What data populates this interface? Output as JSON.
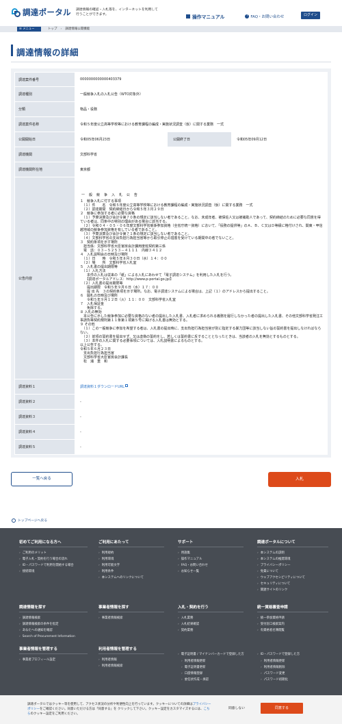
{
  "header": {
    "logo_text": "調達ポータル",
    "tagline": "調達情報の確認・入札等を、インターネットを利用して行うことができます。",
    "manual_label": "操作マニュアル",
    "faq_label": "FAQ・お問い合わせ",
    "login_label": "ログイン"
  },
  "breadcrumb": {
    "menu_label": "メニュー",
    "items": [
      "トップ",
      "調達情報公開機能"
    ]
  },
  "page_title": "調達情報の詳細",
  "details": {
    "case_no_label": "調達案件番号",
    "case_no": "0000000000000403379",
    "type_label": "調達種別",
    "type": "一般競争入札の入札公告（WTO対象外）",
    "category_label": "分類",
    "category": "物品・役務",
    "name_label": "調達案件名称",
    "name": "令和５年度公立高等学校等における教育課程の編成・実施状況調査（仮）に関する業務　一式",
    "start_label": "公開開始日",
    "start": "令和05年06月23日",
    "end_label": "公開終了日",
    "end": "令和05年09月12日",
    "org_label": "調達機関",
    "org": "文部科学省",
    "location_label": "調達機関所在地",
    "location": "東京都",
    "notice_label": "公告内容",
    "notice_title": "一 般 競 争 入 札 公 告",
    "notice_body": "１　競争入札に付する事項\n　（１）件　　名　令和５年度公立高等学校等における教育課程の編成・実施状況調査（仮）に関する業務　一式\n　（２）調達期間　契約締結日から令和５年３月２９日\n２　競争に参加する者に必要な資格\n　（１）予算決算及び会計令第７０条の規定に該当しない者であること。なお、未成年者、被保佐人又は被補助人であって、契約締結のために必要な同意を得ている者は、同条中の特別の理由がある場合に該当する。\n　（２）令和０４・０５・０６年度文部科学省競争参加資格（全省庁統一資格）において、「役務の提供等」のＡ、Ｂ、Ｃ又はＤ等級に格付けされ、関東・甲信越地域の競争参加資格を有している者であること。\n　（３）予算決算及び会計令第７１条の規定に該当しない者であること。\n　（４）文部科学省の支出負担行為担当官等から取引停止の措置を受けている期間中の者でないこと。\n３　契約条項を示す場所\n　担当係：文部科学省大臣官房会計課用度班契約第三係\n　電　話：０３－５２５３－４１１１　内線３４１２\n４　入札説明会の日時及び場所\n　（１）日　　時　令和５年８月３０日（水）１４：００\n　（２）場　　所　文部科学省入札室\n５　入札書の提出期限等\n　（１）入札方法\n　　本件の入札は従来の「紙」による入札にあわせて「電子調達システム」を利用した入札を行う。\n　　【調達ポータルアドレス：http://www.p-portal.go.jp/】\n　（２）入札書の提出期限等\n　　提出期限　令和５年９月６日（水）１７：００\n　　提 出 先　３の契約条項を示す場所。なお、電子調達システムによる場合は、上記（１）のアドレスから提出すること。\n６　開札の日時及び場所\n　　令和５年９月１２日（火）１１：００　文部科学省入札室\n７　入札保証金\n　　免除する。\n８ 入札の無効\n　本公告に示した競争参加に必要な資格のない者の提出した入札書、入札者に求められる義務を履行しなかった者の提出した入札書、その他文部科学省発注工事請負等契約規則第１１条第１項第５号に掲げる入札書は無効とする。\n９ その他\n　（１）この一般競争に参加を希望する者は、入札書の提出時に、支出負担行為担当官が別に指定する暴力団等に該当しない旨の誓約書を提出しなければならない。\n　（２）前項の誓約書を提出せず、又は虚偽の誓約をし、若しくは誓約書に反することとなったときは、当該者の入札を無効とするものとする。\n　（３）本件の入札に関する必要事項については、入札説明書によるものとする。\n以上公告する。\n令和５年６月２３日\n　支出負担行為担当官\n　文部科学省大臣官房会計課長\n　松　浦　重　和",
    "doc1_label": "調達資料１",
    "doc1": "調達資料１ダウンロードURL",
    "doc2_label": "調達資料２",
    "doc2": "-",
    "doc3_label": "調達資料３",
    "doc3": "-",
    "doc4_label": "調達資料４",
    "doc4": "-",
    "doc5_label": "調達資料５",
    "doc5": "-"
  },
  "buttons": {
    "back": "一覧へ戻る",
    "bid": "入札"
  },
  "to_top": "トップページへ戻る",
  "footer": {
    "col1": {
      "title": "初めてご利用になる方へ",
      "items": [
        "ご利用のメリット",
        "電子入札・契約を行う場合の流れ",
        "ID・パスワードで利用を開始する場合",
        "接続環境"
      ]
    },
    "col2": {
      "title": "ご利用にあたって",
      "items": [
        "利用規約",
        "利用環境",
        "利用可能文字",
        "利用条件",
        "本システムへのリンクについて"
      ]
    },
    "col3": {
      "title": "サポート",
      "items": [
        "用語集",
        "操作マニュアル",
        "FAQ・お問い合わせ",
        "お知らせ一覧"
      ]
    },
    "col4": {
      "title": "調達ポータルについて",
      "items": [
        "本システムの説明",
        "本システムの推奨環境",
        "プライバシーポリシー",
        "免責について",
        "ウェブアクセシビリティについて",
        "セキュリティについて",
        "関連サイトのリンク"
      ]
    },
    "col5": {
      "title": "調達情報を探す",
      "items": [
        "調達情報検索",
        "調達情報検索の条件を指定",
        "あなたへの通知を確認",
        "Search of Procurement Information"
      ]
    },
    "col6": {
      "title": "事業者情報を探す",
      "items": [
        "事業者情報検索"
      ]
    },
    "col7": {
      "title": "入札・契約を行う",
      "items": [
        "入札業務",
        "入札結果確認",
        "契約業務"
      ]
    },
    "col8": {
      "title": "統一資格審査申請",
      "items": [
        "統一参加資格申請",
        "受付窓口検索案内",
        "有資格者名簿閲覧"
      ]
    },
    "col9": {
      "title": "事業者情報を管理する",
      "items": [
        "事業者プロフィール設定"
      ]
    },
    "col10": {
      "title": "利用者情報を管理する",
      "items": [
        "利用者情報",
        "利用者情報検索"
      ]
    },
    "col11": {
      "title": "電子証明書 / マイナンバーカードで登録した方",
      "items": [
        "利用者情報更新",
        "電子証明書更新",
        "口座情報登録",
        "委任状作成・承認"
      ]
    },
    "col12": {
      "title": "ID・パスワードで登録した方",
      "items": [
        "利用者情報更新",
        "利用者情報削除",
        "パスワード変更",
        "パスワード初期化"
      ]
    }
  },
  "cookie": {
    "text1": "調達ポータルではクッキー等を使用して、アクセス状況の分析や利便性向上を行っています。クッキーについての詳細は",
    "privacy_link": "プライバシーポリシー",
    "text2": "をご確認ください。同意いただける方は「同意する」を クリックして下さい。クッキー設定をカスタマイズするには、",
    "here_link": "こちら",
    "text3": "のクッキー設定をご利用ください。",
    "deny": "同意しない",
    "agree": "同意する"
  }
}
